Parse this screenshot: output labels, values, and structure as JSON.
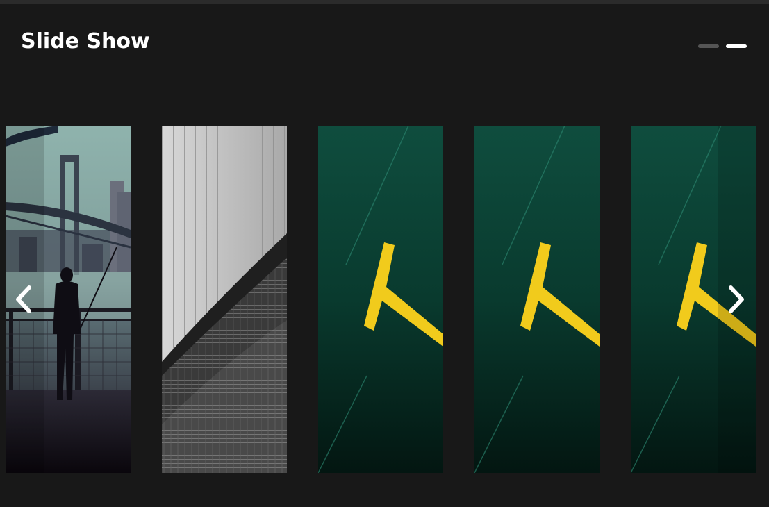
{
  "header": {
    "title": "Slide Show"
  },
  "pager": {
    "count": 2,
    "active_index": 1
  },
  "slides": [
    {
      "subject": "bridge-fisherman-photo"
    },
    {
      "subject": "building-facade-photo"
    },
    {
      "subject": "yellow-road-marking-photo"
    },
    {
      "subject": "yellow-road-marking-photo"
    },
    {
      "subject": "yellow-road-marking-photo"
    }
  ],
  "nav": {
    "prev_icon": "chevron-left-icon",
    "next_icon": "chevron-right-icon"
  },
  "colors": {
    "background": "#181818",
    "title": "#ffffff",
    "pager_active": "#ffffff",
    "pager_inactive": "#555555",
    "marking_yellow": "#f1cb1c",
    "asphalt_green": "#0c3a2f"
  }
}
